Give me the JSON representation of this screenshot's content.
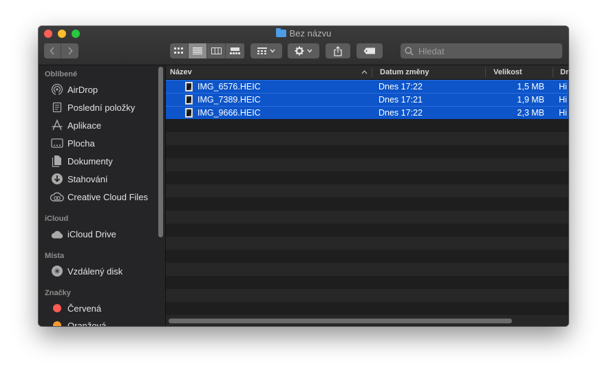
{
  "window": {
    "title": "Bez názvu"
  },
  "toolbar": {
    "view_modes": [
      "icon-view",
      "list-view",
      "column-view",
      "gallery-view"
    ],
    "active_view": "list-view"
  },
  "search": {
    "placeholder": "Hledat",
    "value": ""
  },
  "sidebar": {
    "sections": [
      {
        "header": "Oblíbené",
        "items": [
          {
            "label": "AirDrop",
            "icon": "airdrop-icon"
          },
          {
            "label": "Poslední položky",
            "icon": "recents-icon"
          },
          {
            "label": "Aplikace",
            "icon": "applications-icon"
          },
          {
            "label": "Plocha",
            "icon": "desktop-icon"
          },
          {
            "label": "Dokumenty",
            "icon": "documents-icon"
          },
          {
            "label": "Stahování",
            "icon": "downloads-icon"
          },
          {
            "label": "Creative Cloud Files",
            "icon": "creative-cloud-icon"
          }
        ]
      },
      {
        "header": "iCloud",
        "items": [
          {
            "label": "iCloud Drive",
            "icon": "icloud-icon"
          }
        ]
      },
      {
        "header": "Místa",
        "items": [
          {
            "label": "Vzdálený disk",
            "icon": "remote-disc-icon"
          }
        ]
      },
      {
        "header": "Značky",
        "items": [
          {
            "label": "Červená",
            "color": "#fd5a55"
          },
          {
            "label": "Oranžová",
            "color": "#fd9a30"
          }
        ]
      }
    ]
  },
  "columns": {
    "name": "Název",
    "date": "Datum změny",
    "size": "Velikost",
    "kind": "Druh"
  },
  "files": [
    {
      "name": "IMG_6576.HEIC",
      "date": "Dnes 17:22",
      "size": "1,5 MB",
      "kind": "Hi"
    },
    {
      "name": "IMG_7389.HEIC",
      "date": "Dnes 17:21",
      "size": "1,9 MB",
      "kind": "Hi"
    },
    {
      "name": "IMG_9666.HEIC",
      "date": "Dnes 17:22",
      "size": "2,3 MB",
      "kind": "Hi"
    }
  ],
  "colors": {
    "selection": "#0d55c9",
    "folder": "#4c9de6"
  }
}
